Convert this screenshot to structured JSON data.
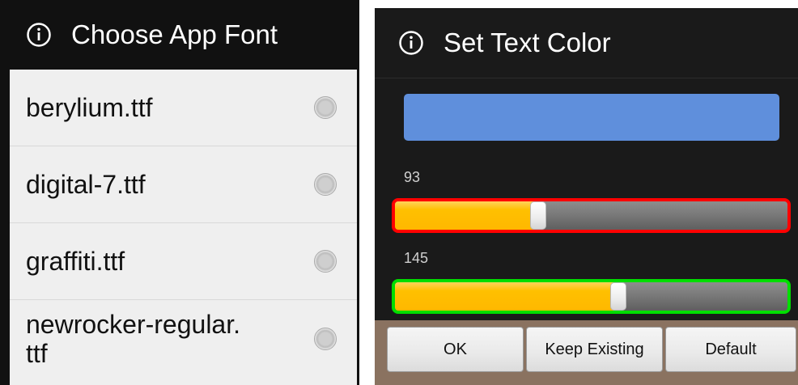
{
  "font_dialog": {
    "title": "Choose App Font",
    "icon": "info-icon",
    "items": [
      {
        "label": "berylium.ttf",
        "selected": false
      },
      {
        "label": "digital-7.ttf",
        "selected": false
      },
      {
        "label": "graffiti.ttf",
        "selected": false
      },
      {
        "label": "newrocker-regular.\nttf",
        "selected": false
      }
    ]
  },
  "color_dialog": {
    "title": "Set Text Color",
    "icon": "info-icon",
    "preview_color": "#5f8fdc",
    "sliders": [
      {
        "value": "93",
        "max": 255,
        "border_color": "#ff0000"
      },
      {
        "value": "145",
        "max": 255,
        "border_color": "#00dd00"
      }
    ],
    "buttons": {
      "ok": "OK",
      "keep_existing": "Keep Existing",
      "default": "Default"
    }
  }
}
